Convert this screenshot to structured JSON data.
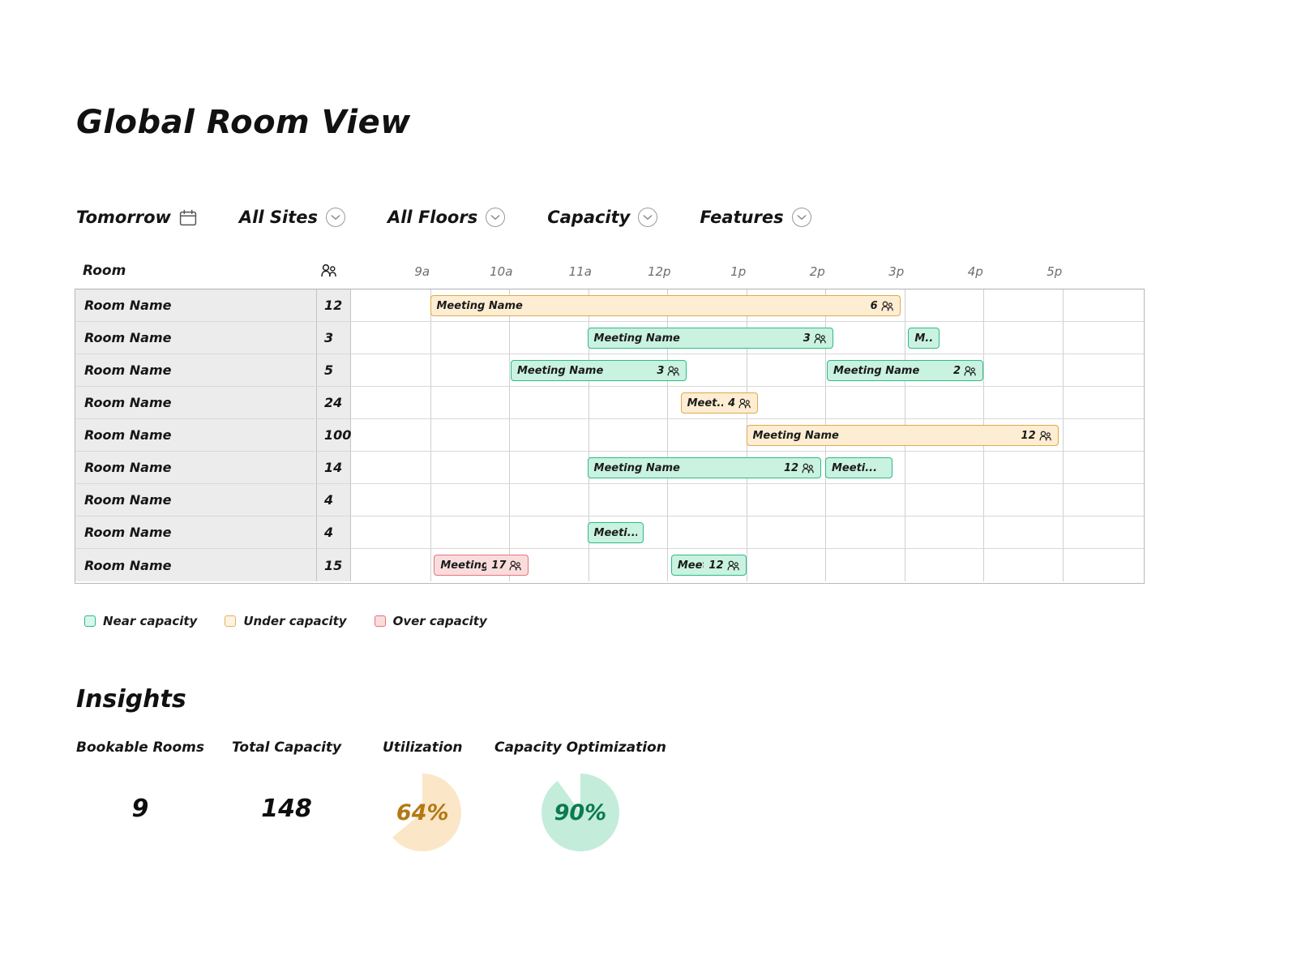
{
  "page": {
    "title": "Global Room View"
  },
  "filters": [
    {
      "label": "Tomorrow",
      "icon": "calendar-icon"
    },
    {
      "label": "All Sites",
      "icon": "chevron-down-icon"
    },
    {
      "label": "All Floors",
      "icon": "chevron-down-icon"
    },
    {
      "label": "Capacity",
      "icon": "chevron-down-icon"
    },
    {
      "label": "Features",
      "icon": "chevron-down-icon"
    }
  ],
  "grid": {
    "headers": {
      "room": "Room",
      "capacity_icon": "people-icon"
    },
    "time_labels": [
      "9a",
      "10a",
      "11a",
      "12p",
      "1p",
      "2p",
      "3p",
      "4p",
      "5p"
    ],
    "rows": [
      {
        "room": "Room Name",
        "capacity": "12",
        "bookings": [
          {
            "label": "Meeting Name",
            "count": "6",
            "status": "under",
            "start": 1.0,
            "end": 6.95
          }
        ]
      },
      {
        "room": "Room Name",
        "capacity": "3",
        "bookings": [
          {
            "label": "Meeting Name",
            "count": "3",
            "status": "near",
            "start": 2.99,
            "end": 6.1
          },
          {
            "label": "M...",
            "count": "",
            "status": "near",
            "start": 7.05,
            "end": 7.45
          }
        ]
      },
      {
        "room": "Room Name",
        "capacity": "5",
        "bookings": [
          {
            "label": "Meeting Name",
            "count": "3",
            "status": "near",
            "start": 2.02,
            "end": 4.25
          },
          {
            "label": "Meeting Name",
            "count": "2",
            "status": "near",
            "start": 6.02,
            "end": 8.0
          }
        ]
      },
      {
        "room": "Room Name",
        "capacity": "24",
        "bookings": [
          {
            "label": "Meet...",
            "count": "4",
            "status": "under",
            "start": 4.17,
            "end": 5.15
          }
        ]
      },
      {
        "room": "Room Name",
        "capacity": "100",
        "bookings": [
          {
            "label": "Meeting Name",
            "count": "12",
            "status": "under",
            "start": 5.0,
            "end": 8.95
          }
        ]
      },
      {
        "room": "Room Name",
        "capacity": "14",
        "bookings": [
          {
            "label": "Meeting Name",
            "count": "12",
            "status": "near",
            "start": 2.99,
            "end": 5.95
          },
          {
            "label": "Meeti...",
            "count": "",
            "status": "near",
            "start": 6.0,
            "end": 6.85
          }
        ]
      },
      {
        "room": "Room Name",
        "capacity": "4",
        "bookings": []
      },
      {
        "room": "Room Name",
        "capacity": "4",
        "bookings": [
          {
            "label": "Meeti...",
            "count": "",
            "status": "near",
            "start": 2.99,
            "end": 3.7
          }
        ]
      },
      {
        "room": "Room Name",
        "capacity": "15",
        "bookings": [
          {
            "label": "Meeting N...",
            "count": "17",
            "status": "over",
            "start": 1.05,
            "end": 2.25
          },
          {
            "label": "Meet...",
            "count": "12",
            "status": "near",
            "start": 4.05,
            "end": 5.0
          }
        ]
      }
    ]
  },
  "legend": [
    {
      "label": "Near capacity",
      "status": "near"
    },
    {
      "label": "Under capacity",
      "status": "under"
    },
    {
      "label": "Over capacity",
      "status": "over"
    }
  ],
  "insights": {
    "title": "Insights",
    "stats": [
      {
        "label": "Bookable Rooms",
        "value": "9",
        "type": "number"
      },
      {
        "label": "Total Capacity",
        "value": "148",
        "type": "number"
      },
      {
        "label": "Utilization",
        "value": "64%",
        "type": "pie",
        "percent": 64,
        "color": "#fbe7c8",
        "text_color": "#b37814"
      },
      {
        "label": "Capacity Optimization",
        "value": "90%",
        "type": "pie",
        "percent": 90,
        "color": "#c3ecdb",
        "text_color": "#0b7a52"
      }
    ]
  },
  "colors": {
    "near_fill": "#c9f2e0",
    "near_border": "#2fb98a",
    "under_fill": "#fdedd2",
    "under_border": "#dfa94b",
    "over_fill": "#fbdcdc",
    "over_border": "#e5737b"
  }
}
